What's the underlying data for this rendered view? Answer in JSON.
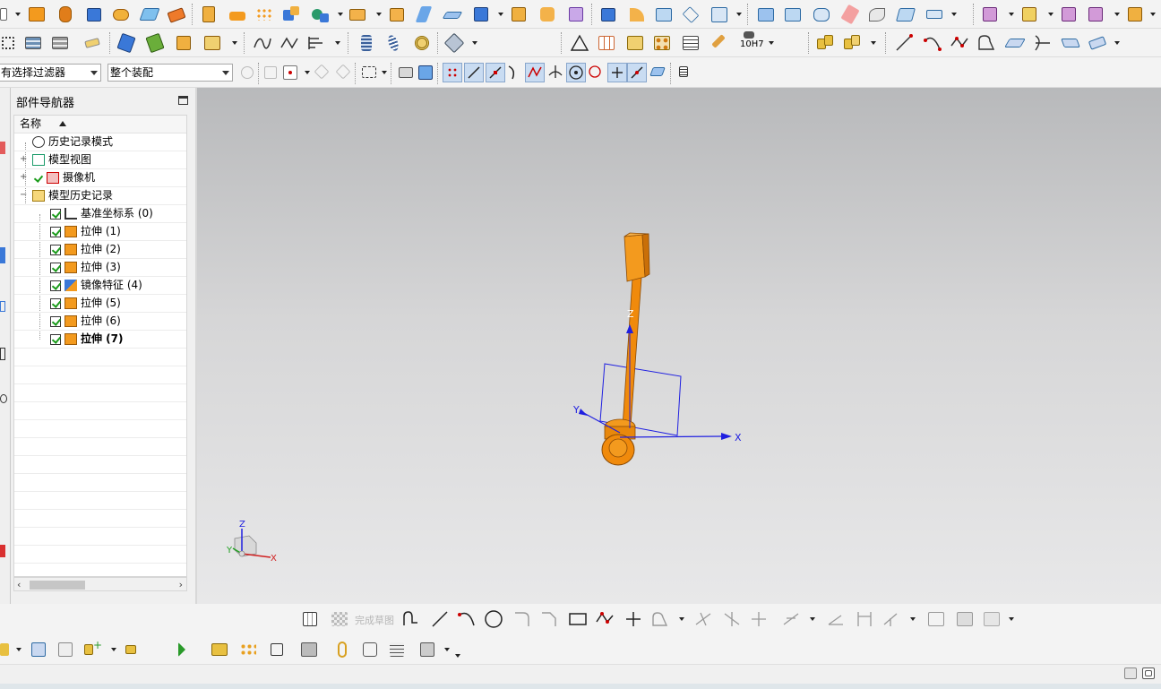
{
  "toolbar_row1": {
    "icons": [
      "new-part-icon",
      "extrude-icon",
      "revolve-icon",
      "block-icon",
      "cylinder-icon",
      "cone-icon",
      "sphere-icon",
      "boolean-unite-icon",
      "boolean-subtract-icon",
      "boolean-intersect-icon",
      "pattern-feature-icon",
      "mirror-feature-icon",
      "offset-face-icon",
      "trim-body-icon",
      "split-body-icon",
      "edge-blend-icon",
      "chamfer-icon",
      "shell-icon",
      "draft-icon",
      "swept-icon",
      "through-curves-icon",
      "studio-surface-icon",
      "bounded-plane-icon",
      "sew-icon",
      "n-sided-surface-icon",
      "ruled-icon",
      "face-blend-icon",
      "trim-sheet-icon",
      "extend-sheet-icon",
      "thicken-icon",
      "move-face-icon",
      "replace-face-icon",
      "delete-face-icon",
      "offset-region-icon",
      "resize-blend-icon",
      "more-icon"
    ]
  },
  "toolbar_row2": {
    "icons": [
      "layer-settings-icon",
      "layer-visible-icon",
      "move-to-layer-icon",
      "hide-icon",
      "show-icon",
      "show-hide-icon",
      "edit-object-display-icon",
      "text-note-icon",
      "curve-icon",
      "surface-wave-icon",
      "measure-icon",
      "spring-icon",
      "coil-icon",
      "gear-icon",
      "triangle-icon",
      "table-icon",
      "grid-point-icon",
      "pattern-point-icon",
      "info-icon",
      "brush-icon",
      "hole-fit-icon",
      "assembly-icon",
      "component-icon",
      "line-icon",
      "arc-icon",
      "spline-icon",
      "curve-fillet-icon",
      "project-curve-icon",
      "intersect-curve-icon",
      "bridge-curve-icon",
      "offset-curve-icon"
    ],
    "fit_label": "10H7"
  },
  "selection_bar": {
    "filter_value": "有选择过滤器",
    "scope_value": "整个装配"
  },
  "part_navigator": {
    "title": "部件导航器",
    "column_name": "名称",
    "nodes": [
      {
        "label": "历史记录模式",
        "icon": "clock-icon"
      },
      {
        "label": "模型视图",
        "icon": "model-views-icon"
      },
      {
        "label": "摄像机",
        "icon": "camera-icon"
      },
      {
        "label": "模型历史记录",
        "icon": "folder-open-icon"
      },
      {
        "label": "基准坐标系 (0)",
        "icon": "datum-csys-icon"
      },
      {
        "label": "拉伸 (1)",
        "icon": "extrude-icon"
      },
      {
        "label": "拉伸 (2)",
        "icon": "extrude-icon"
      },
      {
        "label": "拉伸 (3)",
        "icon": "extrude-icon"
      },
      {
        "label": "镜像特征 (4)",
        "icon": "mirror-feature-icon"
      },
      {
        "label": "拉伸 (5)",
        "icon": "extrude-icon"
      },
      {
        "label": "拉伸 (6)",
        "icon": "extrude-icon"
      },
      {
        "label": "拉伸 (7)",
        "icon": "extrude-icon"
      }
    ]
  },
  "viewport": {
    "axis_x": "X",
    "axis_y": "Y",
    "axis_z": "Z",
    "model_color": "#f08a0c",
    "model_edge_color": "#8a4a05",
    "csys_color": "#1f1fe0"
  },
  "sketch_toolbar": {
    "finish_sketch_label": "完成草图"
  },
  "colors": {
    "accent_blue": "#1e5cd6",
    "orange": "#f39a1e",
    "green_check": "#1a9b1a"
  }
}
